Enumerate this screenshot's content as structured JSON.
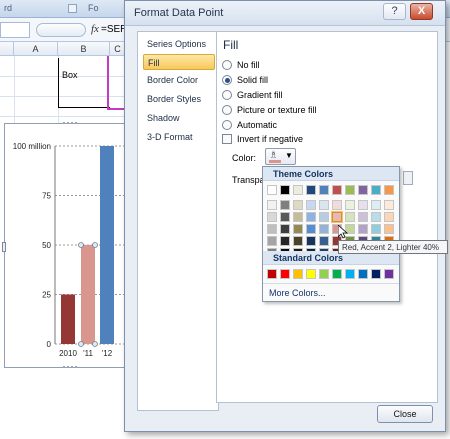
{
  "excel": {
    "ribbon": {
      "left_text": "rd",
      "right_text": "Fo"
    },
    "formula_bar": {
      "fx_label": "fx",
      "formula_value": "=SERI"
    },
    "columns": [
      "A",
      "B",
      "C"
    ],
    "cell_text": "Box"
  },
  "chart": {
    "y_ticks": [
      "100 million",
      "75",
      "50",
      "25",
      "0"
    ]
  },
  "chart_data": {
    "type": "bar",
    "categories": [
      "2010",
      "'11",
      "'12"
    ],
    "values": [
      25,
      50,
      100
    ],
    "colors": [
      "#953735",
      "#d9968e",
      "#4f81bd"
    ],
    "ylim": [
      0,
      100
    ],
    "y_tick_labels": [
      "0",
      "25",
      "50",
      "75",
      "100 million"
    ],
    "gridlines": "dashed-horizontal",
    "selected_point": "'11"
  },
  "dialog": {
    "title": "Format Data Point",
    "help_button": "?",
    "close_button": "X",
    "nav": [
      "Series Options",
      "Fill",
      "Border Color",
      "Border Styles",
      "Shadow",
      "3-D Format"
    ],
    "nav_selected": "Fill",
    "panel_title": "Fill",
    "fill_options": [
      {
        "label": "No fill",
        "type": "radio",
        "checked": false
      },
      {
        "label": "Solid fill",
        "type": "radio",
        "checked": true
      },
      {
        "label": "Gradient fill",
        "type": "radio",
        "checked": false
      },
      {
        "label": "Picture or texture fill",
        "type": "radio",
        "checked": false
      },
      {
        "label": "Automatic",
        "type": "radio",
        "checked": false
      },
      {
        "label": "Invert if negative",
        "type": "checkbox",
        "checked": false
      }
    ],
    "color_label": "Color:",
    "transparency_label": "Transpa",
    "close_label": "Close",
    "current_color": "#d9958c"
  },
  "gallery": {
    "theme_title": "Theme Colors",
    "standard_title": "Standard Colors",
    "more_colors": "More Colors...",
    "tooltip": "Red, Accent 2, Lighter 40%",
    "hovered": "Red, Accent 2, Lighter 40%",
    "theme_top": [
      "#ffffff",
      "#000000",
      "#eeece1",
      "#1f497d",
      "#4f81bd",
      "#c0504d",
      "#9bbb59",
      "#8064a2",
      "#4bacc6",
      "#f79646"
    ],
    "theme_shades": [
      [
        "#f2f2f2",
        "#7f7f7f",
        "#ddd9c3",
        "#c6d9f0",
        "#dbe5f1",
        "#f2dcdb",
        "#ebf1dd",
        "#e5e0ec",
        "#dbeef3",
        "#fdeada"
      ],
      [
        "#d8d8d8",
        "#595959",
        "#c4bd97",
        "#8db3e2",
        "#b8cce4",
        "#e5b9b7",
        "#d7e3bc",
        "#ccc1d9",
        "#b7dde8",
        "#fbd5b5"
      ],
      [
        "#bfbfbf",
        "#3f3f3f",
        "#938953",
        "#548dd4",
        "#95b3d7",
        "#d99694",
        "#c3d69b",
        "#b2a2c7",
        "#92cddc",
        "#fac08f"
      ],
      [
        "#a5a5a5",
        "#262626",
        "#494429",
        "#17365d",
        "#366092",
        "#953734",
        "#76923c",
        "#5f497a",
        "#31859b",
        "#e36c09"
      ],
      [
        "#7f7f7f",
        "#0c0c0c",
        "#1d1b10",
        "#0f243e",
        "#244061",
        "#632423",
        "#4f6128",
        "#3f3151",
        "#205867",
        "#974806"
      ]
    ],
    "standard": [
      "#c00000",
      "#ff0000",
      "#ffc000",
      "#ffff00",
      "#92d050",
      "#00b050",
      "#00b0f0",
      "#0070c0",
      "#002060",
      "#7030a0"
    ]
  }
}
